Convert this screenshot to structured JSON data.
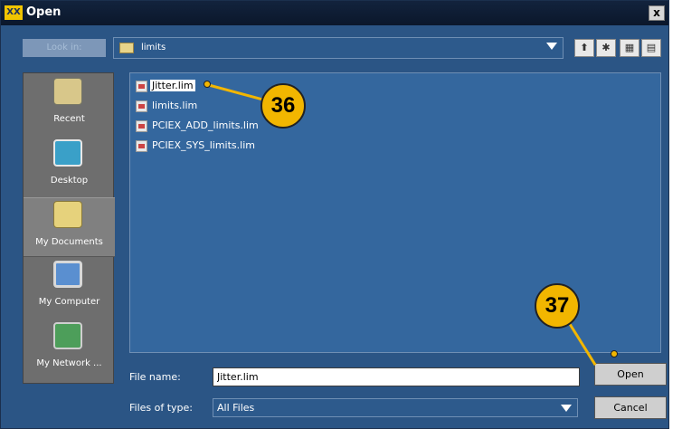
{
  "window": {
    "app_icon_text": "XX",
    "title": "Open",
    "close_label": "x"
  },
  "toolbar": {
    "look_in_label": "Look in:",
    "path": "limits",
    "buttons": [
      {
        "name": "up-folder-button",
        "glyph": "⬆"
      },
      {
        "name": "new-folder-button",
        "glyph": "✱"
      },
      {
        "name": "list-view-button",
        "glyph": "▦"
      },
      {
        "name": "details-view-button",
        "glyph": "▤"
      }
    ]
  },
  "sidebar": {
    "items": [
      {
        "label": "Recent",
        "icon": "recent-icon"
      },
      {
        "label": "Desktop",
        "icon": "desktop-icon"
      },
      {
        "label": "My Documents",
        "icon": "documents-icon",
        "active": true
      },
      {
        "label": "My Computer",
        "icon": "computer-icon"
      },
      {
        "label": "My Network ...",
        "icon": "network-icon"
      }
    ]
  },
  "files": [
    {
      "name": "Jitter.lim",
      "selected": true
    },
    {
      "name": "limits.lim"
    },
    {
      "name": "PCIEX_ADD_limits.lim"
    },
    {
      "name": "PCIEX_SYS_limits.lim"
    }
  ],
  "bottom": {
    "filename_label": "File name:",
    "filename_value": "Jitter.lim",
    "filetype_label": "Files of type:",
    "filetype_value": "All Files",
    "open_label": "Open",
    "cancel_label": "Cancel"
  },
  "callouts": {
    "c36": "36",
    "c37": "37"
  },
  "colors": {
    "dialog_bg": "#2b5585",
    "callout": "#f2b600"
  }
}
